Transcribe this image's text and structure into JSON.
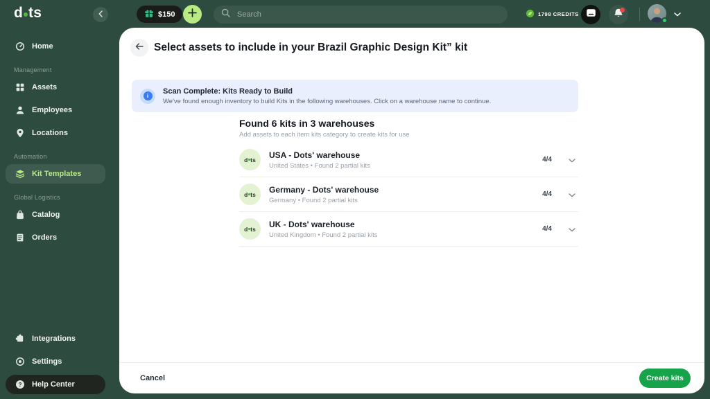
{
  "brand": {
    "name_left": "d",
    "name_right": "ts"
  },
  "icons": {
    "info_glyph": "i",
    "help_glyph": "?"
  },
  "topbar": {
    "balance_label": "$150",
    "search_placeholder": "Search",
    "credits_label": "1798 CREDITS"
  },
  "sidebar": {
    "sections": [
      {
        "label": "Management"
      },
      {
        "label": "Automation"
      },
      {
        "label": "Global Logistics"
      }
    ],
    "items": [
      {
        "label": "Home"
      },
      {
        "label": "Assets"
      },
      {
        "label": "Employees"
      },
      {
        "label": "Locations"
      },
      {
        "label": "Kit Templates"
      },
      {
        "label": "Catalog"
      },
      {
        "label": "Orders"
      },
      {
        "label": "Integrations"
      },
      {
        "label": "Settings"
      },
      {
        "label": "Help Center"
      }
    ]
  },
  "main": {
    "title": "Select assets to include in your Brazil Graphic Design Kit” kit",
    "banner": {
      "title": "Scan Complete: Kits Ready to Build",
      "description": "We've found enough inventory to build Kits in the following warehouses. Click on a warehouse name to continue."
    },
    "results": {
      "heading": "Found 6 kits in 3 warehouses",
      "subheading": "Add assets to each item kits category to create kits for use",
      "warehouses": [
        {
          "name": "USA - Dots' warehouse",
          "meta": "United States • Found 2 partial kits",
          "count": "4/4"
        },
        {
          "name": "Germany - Dots' warehouse",
          "meta": "Germany • Found 2 partial kits",
          "count": "4/4"
        },
        {
          "name": "UK - Dots' warehouse",
          "meta": "United Kingdom • Found 2 partial kits",
          "count": "4/4"
        }
      ]
    },
    "footer": {
      "cancel_label": "Cancel",
      "create_label": "Create kits"
    }
  },
  "colors": {
    "sidebar_bg": "#2d4b3e",
    "accent_green": "#b7ea83",
    "create_button_green": "#16a34a",
    "banner_bg": "#e9effc",
    "info_blue": "#3b7bf6",
    "notification_red": "#ef4444",
    "credits_green": "#5eb53a",
    "status_online_green": "#2fd06a"
  }
}
